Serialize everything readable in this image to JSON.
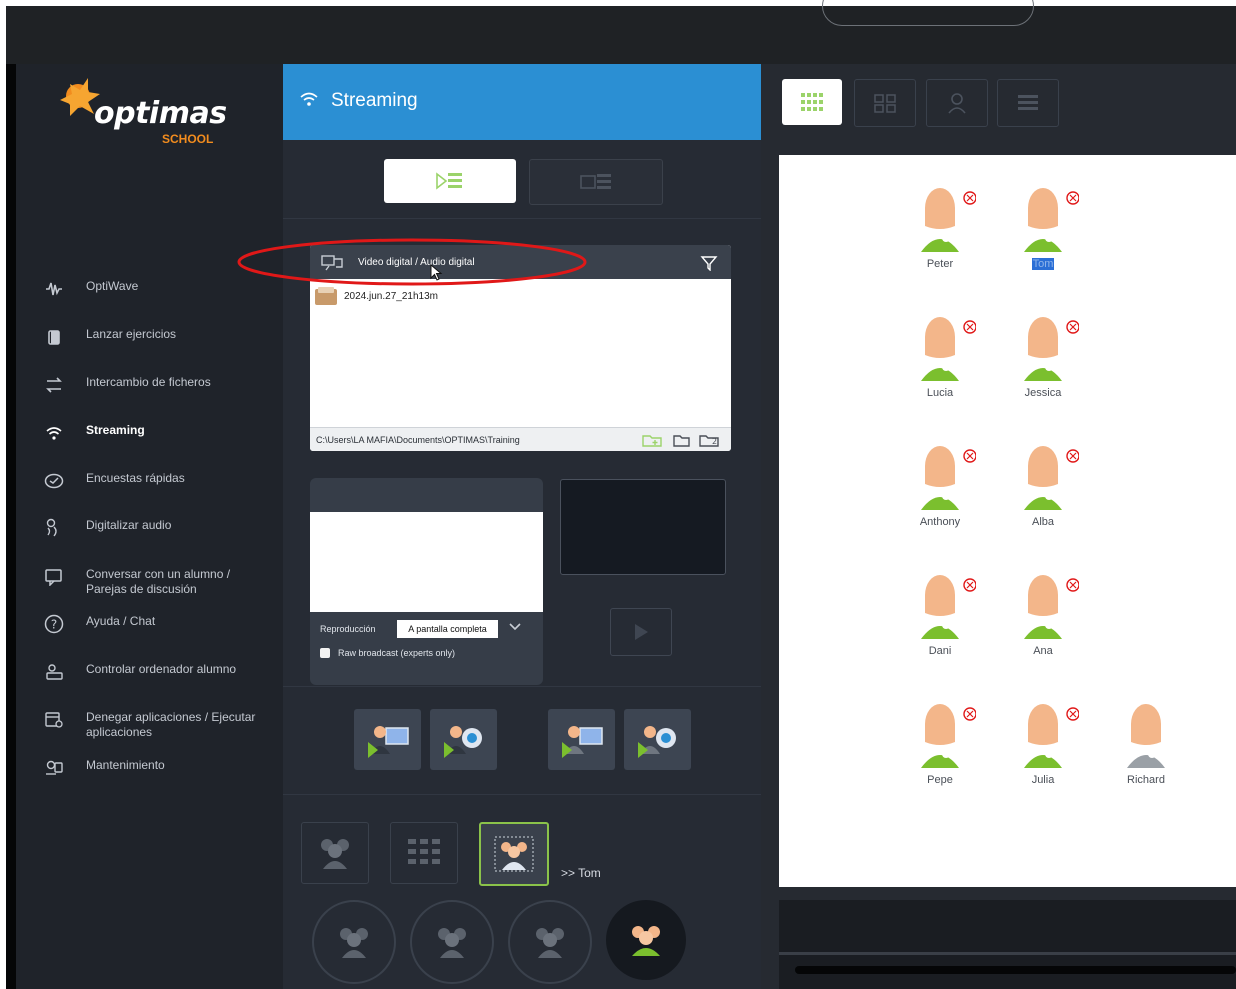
{
  "app": {
    "brand": "optimas",
    "brand_sub": "SCHOOL"
  },
  "sidebar": {
    "items": [
      {
        "label": "OptiWave",
        "icon": "waveform-icon"
      },
      {
        "label": "Lanzar ejercicios",
        "icon": "copy-pages-icon"
      },
      {
        "label": "Intercambio de ficheros",
        "icon": "exchange-arrows-icon"
      },
      {
        "label": "Streaming",
        "icon": "wifi-icon",
        "active": true
      },
      {
        "label": "Encuestas rápidas",
        "icon": "survey-icon"
      },
      {
        "label": "Digitalizar audio",
        "icon": "audio-digitize-icon"
      },
      {
        "label": "Conversar con un alumno / Parejas de discusión",
        "icon": "chat-monitor-icon"
      },
      {
        "label": "Ayuda / Chat",
        "icon": "help-icon"
      },
      {
        "label": "Controlar ordenador alumno",
        "icon": "remote-control-icon"
      },
      {
        "label": "Denegar aplicaciones / Ejecutar aplicaciones",
        "icon": "app-block-icon"
      },
      {
        "label": "Mantenimiento",
        "icon": "maintenance-icon"
      }
    ]
  },
  "streaming": {
    "title": "Streaming",
    "file_panel": {
      "header": "Video digital / Audio digital",
      "files": [
        "2024.jun.27_21h13m"
      ],
      "path": "C:\\Users\\LA MAFIA\\Documents\\OPTIMAS\\Training"
    },
    "player": {
      "playback_label": "Reproducción",
      "playback_value": "A pantalla completa",
      "raw_broadcast_label": "Raw broadcast (experts only)",
      "raw_broadcast_checked": false
    },
    "target_label": ">> Tom"
  },
  "view_buttons": [
    "grid-small-icon",
    "grid-large-icon",
    "student-cam-icon",
    "list-view-icon"
  ],
  "students": [
    {
      "name": "Peter",
      "status": "online"
    },
    {
      "name": "Tom",
      "status": "online",
      "selected": true
    },
    {
      "name": "Lucia",
      "status": "online"
    },
    {
      "name": "Jessica",
      "status": "online"
    },
    {
      "name": "Anthony",
      "status": "online"
    },
    {
      "name": "Alba",
      "status": "online"
    },
    {
      "name": "Dani",
      "status": "online"
    },
    {
      "name": "Ana",
      "status": "online"
    },
    {
      "name": "Pepe",
      "status": "online"
    },
    {
      "name": "Julia",
      "status": "online"
    },
    {
      "name": "Richard",
      "status": "offline"
    }
  ],
  "colors": {
    "accent_blue": "#2b8fd3",
    "online_green": "#7bbf2e",
    "skin": "#f3b68a",
    "offline_gray": "#9aa0a6",
    "annotation_red": "#e01818",
    "selection_blue": "#2b6fd6"
  }
}
